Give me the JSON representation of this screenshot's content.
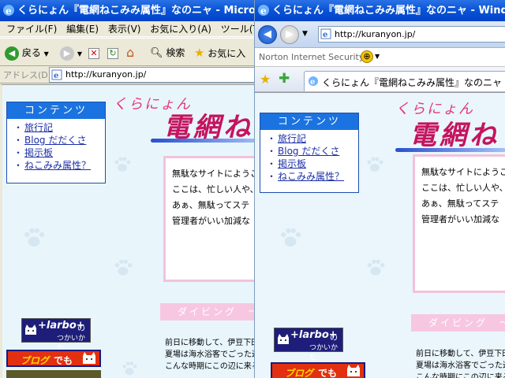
{
  "windows": {
    "left": {
      "title": "くらにょん『電網ねこみみ属性』なのニャ - Microsoft",
      "menus": [
        "ファイル(F)",
        "編集(E)",
        "表示(V)",
        "お気に入り(A)",
        "ツール(T"
      ],
      "toolbar": {
        "back_label": "戻る",
        "search_label": "検索",
        "favorites_label": "お気に入"
      },
      "address_label": "アドレス(D)",
      "address_value": "http://kuranyon.jp/"
    },
    "right": {
      "title": "くらにょん『電網ねこみみ属性』なのニャ - Windows I",
      "address_value": "http://kuranyon.jp/",
      "security_toolbar": "Norton Internet Security",
      "tab_title": "くらにょん『電網ねこみみ属性』なのニャ"
    }
  },
  "page": {
    "logo_small": "くらにょん",
    "logo_big": "電網ね",
    "menu_title": "コンテンツ",
    "menu_items": [
      "旅行記",
      "Blog だだくさ",
      "掲示板",
      "ねこみみ属性？"
    ],
    "intro_lines": [
      "無駄なサイトにようこ",
      "ここは、忙しい人や、",
      "あぁ、無駄ってステ",
      "管理者がいい加減な"
    ],
    "diving_heading": "ダイビング　〜",
    "diary_lines": [
      "前日に移動して、伊豆下田",
      "夏場は海水浴客でごった返",
      "こんな時期にこの辺に来る"
    ],
    "banner_harbot": {
      "brand": "+larbo+",
      "suffix": "の",
      "sub": "つかいかた"
    },
    "banner_blog": {
      "text1": "ブログ",
      "text2": "でも"
    }
  },
  "colors": {
    "titlebar": "#0a55d6",
    "menu_header": "#1a73e0",
    "link": "#1d2fa8",
    "logo": "#c4145e",
    "pink_border": "#f2c2db",
    "page_bg": "#e8f6fc"
  }
}
